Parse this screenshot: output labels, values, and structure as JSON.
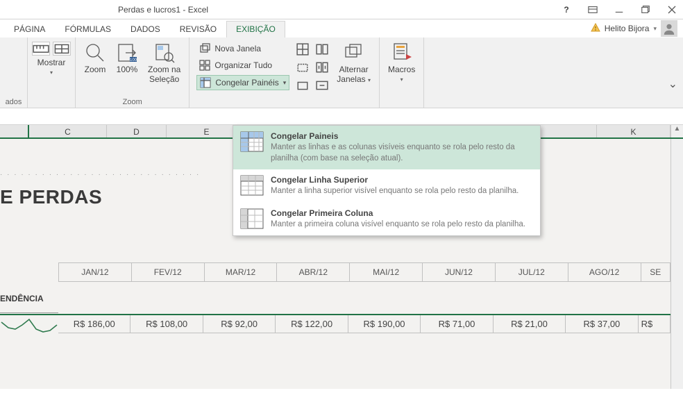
{
  "titlebar": {
    "title": "Perdas e lucros1 - Excel"
  },
  "tabs": {
    "pagina": "PÁGINA",
    "formulas": "FÓRMULAS",
    "dados": "DADOS",
    "revisao": "REVISÃO",
    "exibicao": "EXIBIÇÃO"
  },
  "account": {
    "name": "Helito Bijora"
  },
  "ribbon": {
    "ados": "ados",
    "mostrar": "Mostrar",
    "zoom_group": "Zoom",
    "zoom": "Zoom",
    "pct100": "100%",
    "zoom_sel_1": "Zoom na",
    "zoom_sel_2": "Seleção",
    "nova_janela": "Nova Janela",
    "organizar": "Organizar Tudo",
    "congelar": "Congelar Painéis",
    "alternar_1": "Alternar",
    "alternar_2": "Janelas",
    "macros": "Macros"
  },
  "dropdown": {
    "opt1_title": "Congelar Paineis",
    "opt1_desc": "Manter as linhas e as colunas visíveis enquanto se rola pelo resto da planilha (com base na seleção atual).",
    "opt2_title": "Congelar Linha Superior",
    "opt2_desc": "Manter a linha superior visível enquanto se rola pelo resto da planilha.",
    "opt3_title": "Congelar Primeira Coluna",
    "opt3_desc": "Manter a primeira coluna visível enquanto se rola pelo resto da planilha."
  },
  "columns": {
    "c": "C",
    "d": "D",
    "e": "E",
    "k": "K"
  },
  "sheet": {
    "title": "E PERDAS",
    "tendencia": "ENDÊNCIA",
    "months": [
      "JAN/12",
      "FEV/12",
      "MAR/12",
      "ABR/12",
      "MAI/12",
      "JUN/12",
      "JUL/12",
      "AGO/12",
      "SE"
    ],
    "values": [
      "R$  186,00",
      "R$  108,00",
      "R$    92,00",
      "R$  122,00",
      "R$  190,00",
      "R$    71,00",
      "R$    21,00",
      "R$    37,00",
      "R$"
    ]
  }
}
